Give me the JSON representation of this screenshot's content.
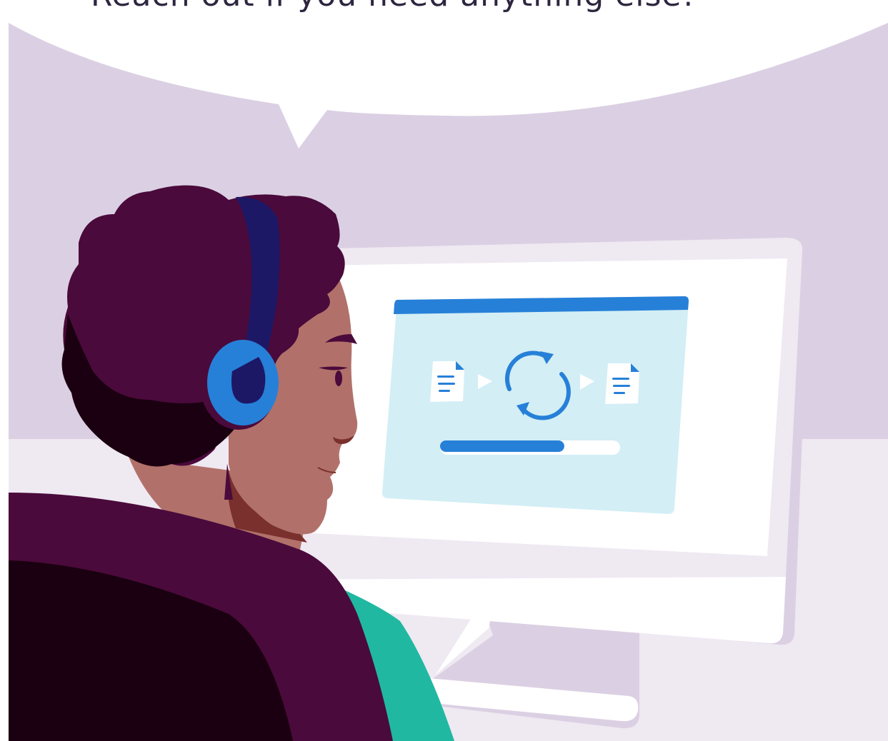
{
  "speech_bubble": {
    "text": "Reach out if you need anything else!"
  },
  "screen_window": {
    "icons": [
      "document-icon",
      "play-arrow-icon",
      "sync-icon",
      "play-arrow-icon",
      "document-icon"
    ],
    "progress": 0.69
  },
  "colors": {
    "wall": "#dbd0e3",
    "floor": "#efe9f2",
    "monitor_frame": "#efe9f2",
    "monitor_shadow": "#dbd0e3",
    "screen": "#ffffff",
    "window_body": "#d3eef5",
    "accent_blue": "#2680d8",
    "hair": "#4a0a3b",
    "hair_shadow": "#1a0010",
    "skin": "#b1716a",
    "headset_band": "#1d1866",
    "shirt": "#20b8a1",
    "chair": "#4a0a3b"
  }
}
